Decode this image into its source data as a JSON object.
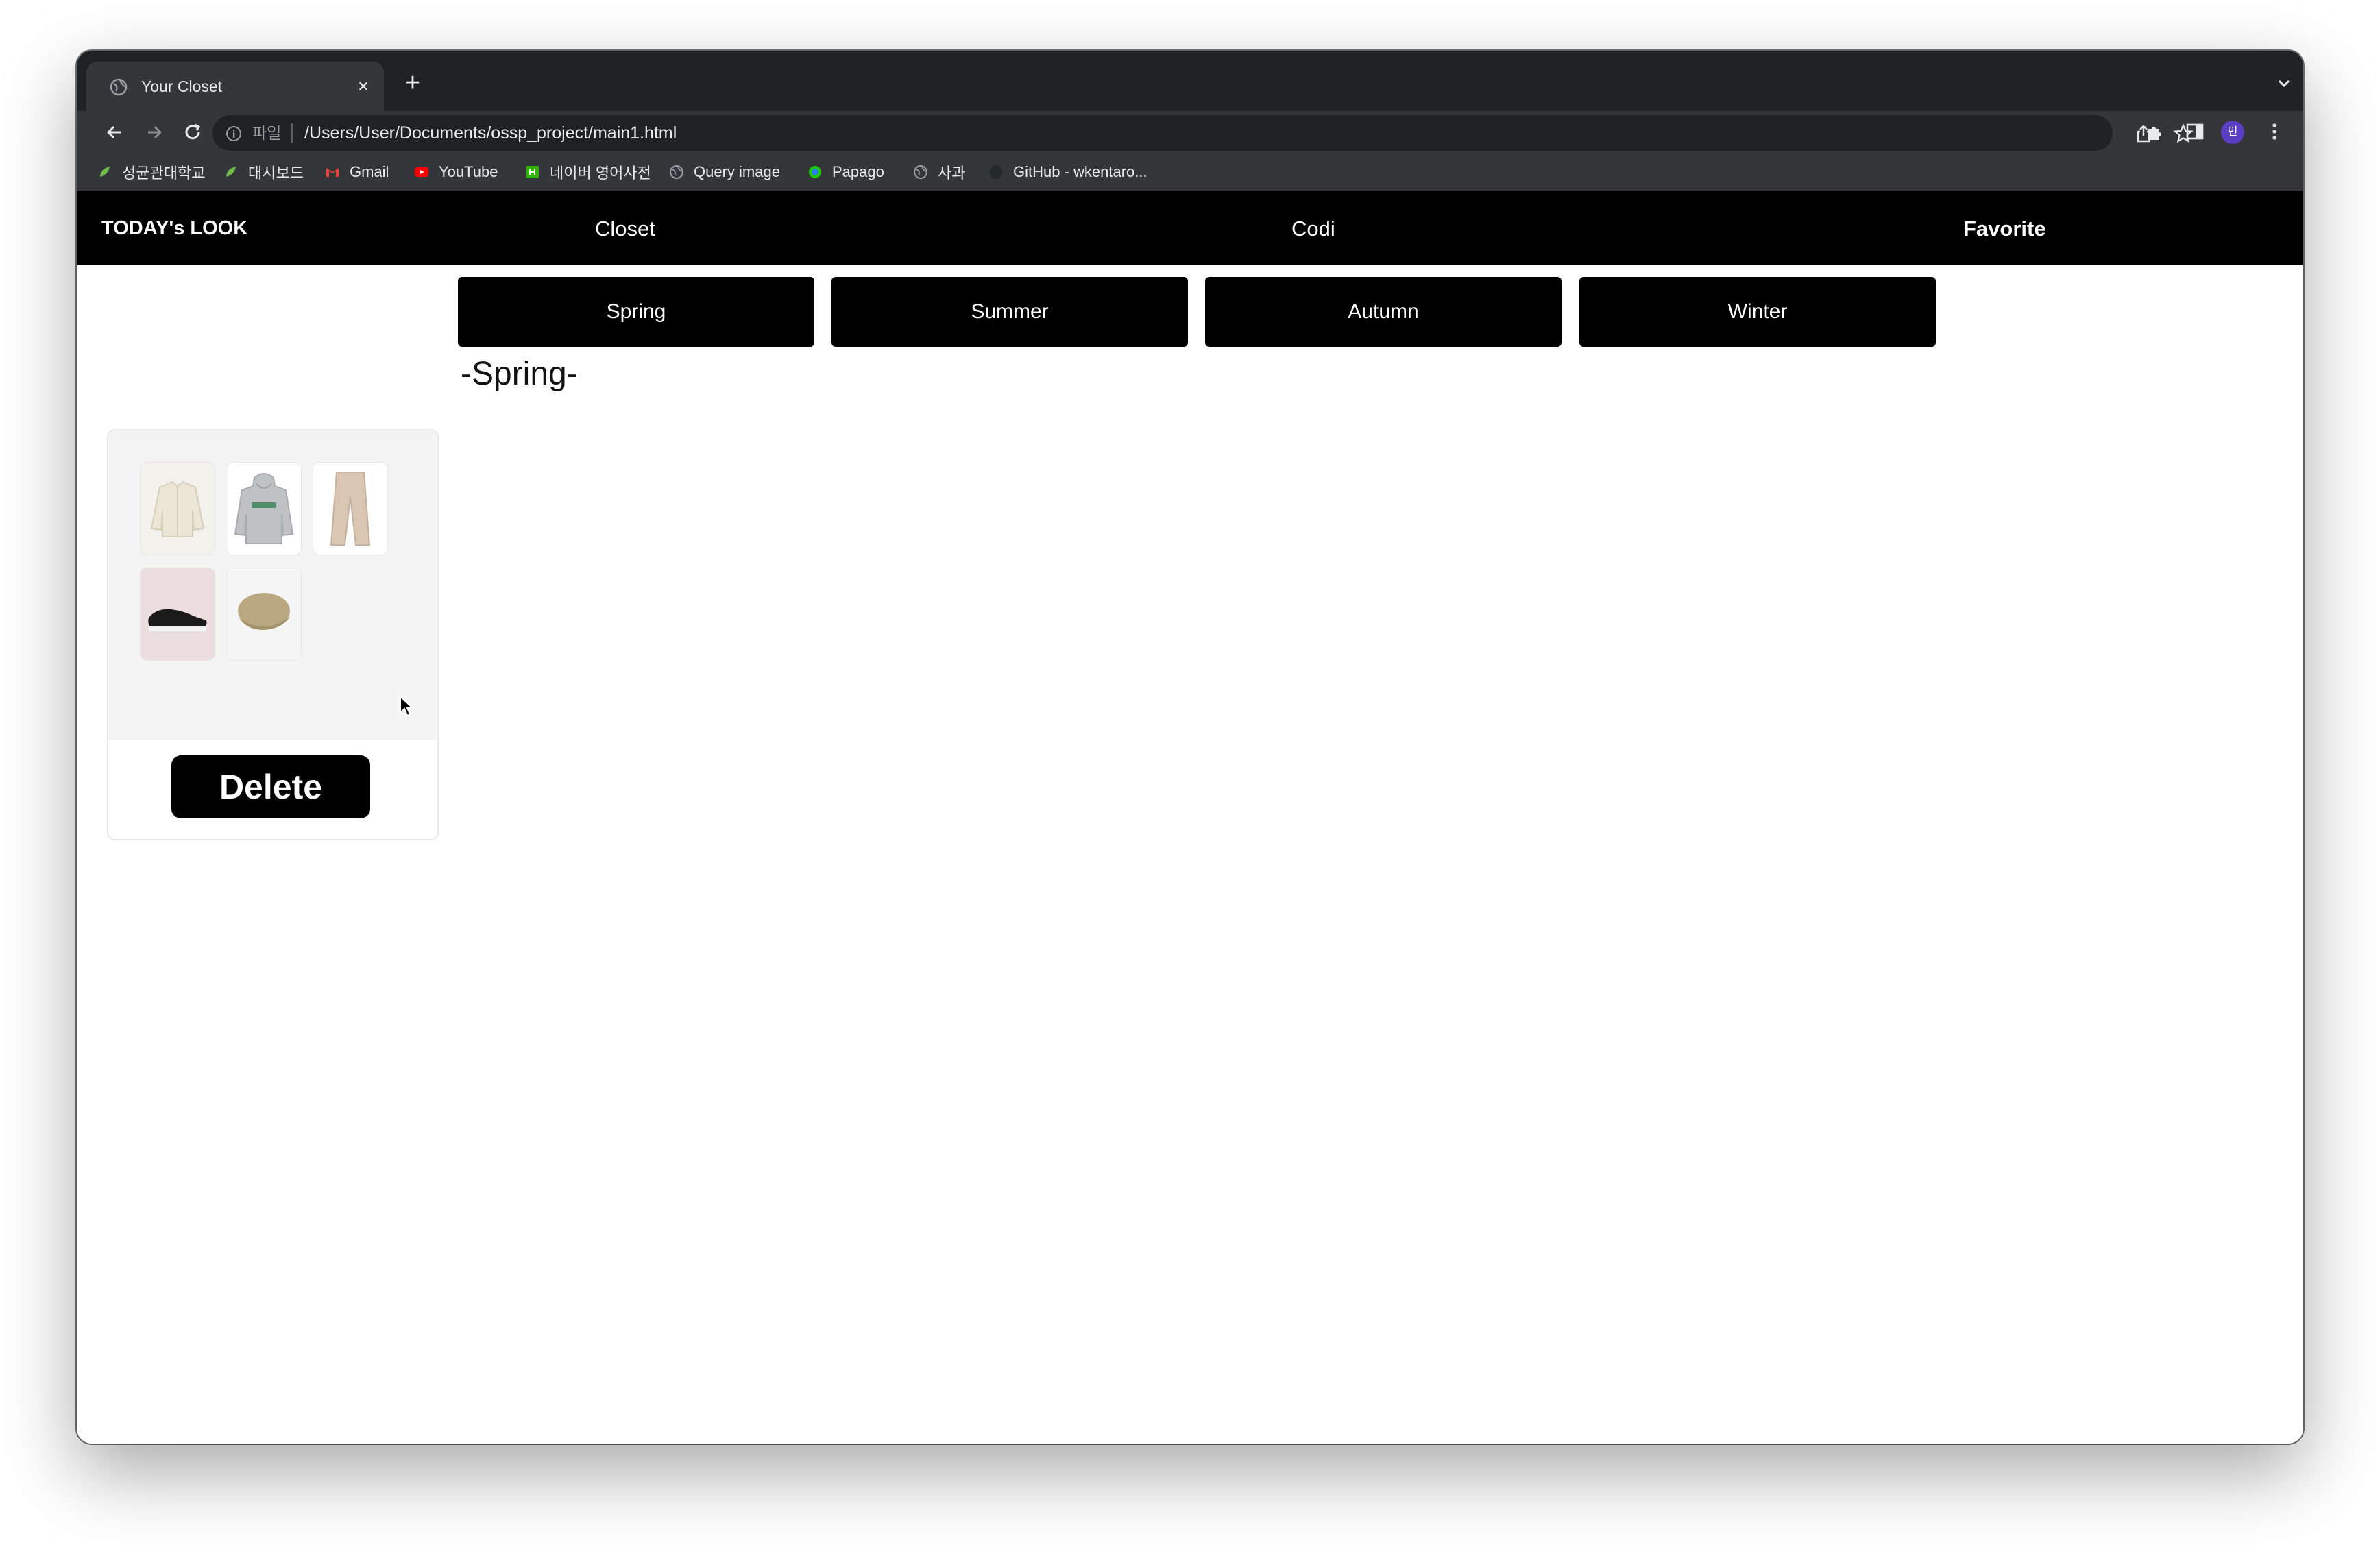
{
  "browser": {
    "tab_title": "Your Closet",
    "url_scheme": "파일",
    "url": "/Users/User/Documents/ossp_project/main1.html",
    "profile_initial": "민",
    "bookmarks": [
      {
        "label": "성균관대학교",
        "icon": "leaf-icon"
      },
      {
        "label": "대시보드",
        "icon": "leaf-icon"
      },
      {
        "label": "Gmail",
        "icon": "gmail-icon"
      },
      {
        "label": "YouTube",
        "icon": "youtube-icon"
      },
      {
        "label": "네이버 영어사전",
        "icon": "naver-dictionary-icon"
      },
      {
        "label": "Query image",
        "icon": "globe-icon"
      },
      {
        "label": "Papago",
        "icon": "papago-icon"
      },
      {
        "label": "사과",
        "icon": "globe-icon"
      },
      {
        "label": "GitHub - wkentaro...",
        "icon": "github-icon"
      }
    ]
  },
  "site": {
    "brand": "TODAY's LOOK",
    "nav": [
      "Closet",
      "Codi",
      "Favorite"
    ],
    "seasons": [
      "Spring",
      "Summer",
      "Autumn",
      "Winter"
    ],
    "current_season_title": "-Spring-",
    "closet_items": [
      "cream-jacket",
      "gray-hoodie",
      "beige-pants",
      "black-sneakers",
      "beige-cap"
    ],
    "delete_label": "Delete"
  },
  "colors": {
    "navbar": "#000000",
    "button": "#000000",
    "chrome_dark": "#202124",
    "chrome_toolbar": "#35363a"
  }
}
